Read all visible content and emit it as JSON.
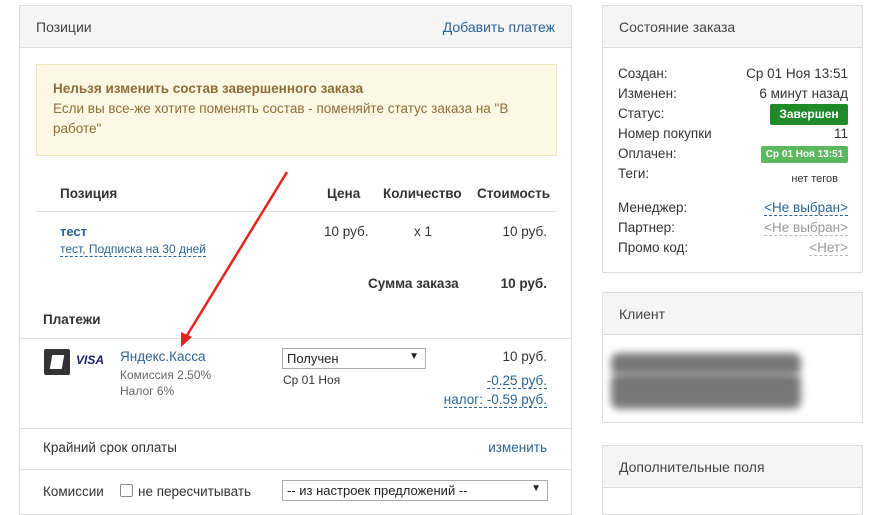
{
  "positions": {
    "title": "Позиции",
    "add_payment": "Добавить платеж",
    "warning_title": "Нельзя изменить состав завершенного заказа",
    "warning_text": "Если вы все-же хотите поменять состав - поменяйте статус заказа на \"В работе\"",
    "headers": {
      "item": "Позиция",
      "price": "Цена",
      "qty": "Количество",
      "cost": "Стоимость"
    },
    "item": {
      "name": "тест",
      "sub": "тест, Подписка на 30 дней",
      "price": "10 руб.",
      "qty": "x 1",
      "cost": "10 руб."
    },
    "total_label": "Сумма заказа",
    "total_value": "10 руб.",
    "payments_title": "Платежи",
    "payment": {
      "icon": "yandex-kassa-icon",
      "visa": "VISA",
      "name": "Яндекс.Касса",
      "commission": "Комиссия 2.50%",
      "tax": "Налог 6%",
      "status_select": "Получен",
      "date": "Ср 01 Ноя",
      "amount": "10 руб.",
      "commission_amount": "-0.25 руб.",
      "tax_amount": "налог: -0.59 руб."
    },
    "deadline_label": "Крайний срок оплаты",
    "deadline_change": "изменить",
    "commissions_label": "Комиссии",
    "no_recalc": "не пересчитывать",
    "commission_select": "-- из настроек предложений --"
  },
  "order_state": {
    "title": "Состояние заказа",
    "created_label": "Создан:",
    "created": "Ср 01 Ноя 13:51",
    "changed_label": "Изменен:",
    "changed": "6 минут назад",
    "status_label": "Статус:",
    "status": "Завершен",
    "status_color": "#1e8a2a",
    "purchase_label": "Номер покупки",
    "purchase": "11",
    "paid_label": "Оплачен:",
    "paid": "Ср 01 Ноя 13:51",
    "paid_color": "#5cb85c",
    "tags_label": "Теги:",
    "tags": "нет тегов",
    "manager_label": "Менеджер:",
    "manager": "<Не выбран>",
    "partner_label": "Партнер:",
    "partner": "<Не выбран>",
    "promo_label": "Промо код:",
    "promo": "<Нет>"
  },
  "client": {
    "title": "Клиент"
  },
  "extra": {
    "title": "Дополнительные поля"
  }
}
